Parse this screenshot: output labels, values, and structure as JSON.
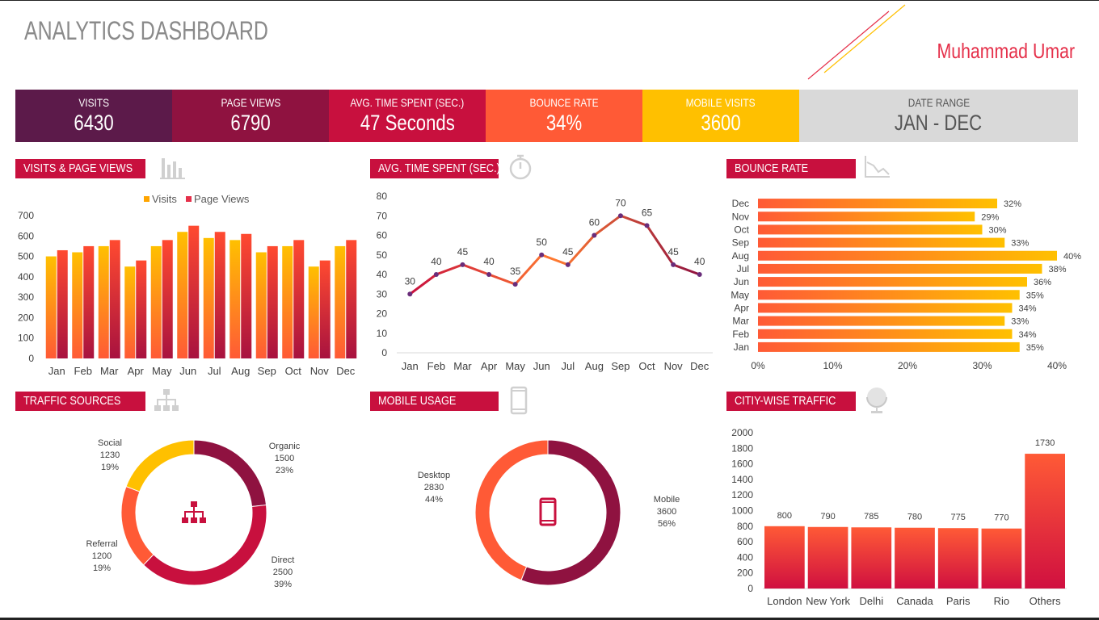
{
  "header": {
    "title": "ANALYTICS DASHBOARD",
    "author": "Muhammad Umar"
  },
  "kpis": [
    {
      "label": "VISITS",
      "value": "6430",
      "color": "#5c1a4a"
    },
    {
      "label": "PAGE VIEWS",
      "value": "6790",
      "color": "#8f1240"
    },
    {
      "label": "AVG. TIME SPENT (SEC.)",
      "value": "47 Seconds",
      "color": "#c8103e"
    },
    {
      "label": "BOUNCE RATE",
      "value": "34%",
      "color": "#ff5a36"
    },
    {
      "label": "MOBILE VISITS",
      "value": "3600",
      "color": "#ffc000"
    },
    {
      "label": "DATE RANGE",
      "value": "JAN - DEC",
      "color": "#d9d9d9"
    }
  ],
  "sections": {
    "visits": "VISITS & PAGE VIEWS",
    "time": "AVG. TIME SPENT (SEC.)",
    "bounce": "BOUNCE RATE",
    "traffic": "TRAFFIC SOURCES",
    "mobile": "MOBILE USAGE",
    "city": "CITIY-WISE TRAFFIC"
  },
  "icons": {
    "visits": "bar-chart-icon",
    "time": "stopwatch-icon",
    "bounce": "declining-area-chart-icon",
    "traffic": "org-chart-icon",
    "mobile": "smartphone-icon",
    "city": "globe-icon"
  },
  "colors": {
    "accent": "#c8103e",
    "yellow": "#ffc000",
    "orange": "#ff5a36",
    "darkred": "#8f1240",
    "axis_text": "#404040"
  },
  "chart_data": [
    {
      "id": "visits_pageviews",
      "type": "bar",
      "categories": [
        "Jan",
        "Feb",
        "Mar",
        "Apr",
        "May",
        "Jun",
        "Jul",
        "Aug",
        "Sep",
        "Oct",
        "Nov",
        "Dec"
      ],
      "series": [
        {
          "name": "Visits",
          "values": [
            500,
            520,
            550,
            450,
            550,
            620,
            590,
            580,
            520,
            550,
            450,
            550
          ]
        },
        {
          "name": "Page Views",
          "values": [
            530,
            550,
            580,
            480,
            580,
            650,
            620,
            610,
            550,
            580,
            480,
            580
          ]
        }
      ],
      "ylim": [
        0,
        700
      ],
      "yticks": [
        0,
        100,
        200,
        300,
        400,
        500,
        600,
        700
      ],
      "legend": "top"
    },
    {
      "id": "avg_time_spent",
      "type": "line",
      "categories": [
        "Jan",
        "Feb",
        "Mar",
        "Apr",
        "May",
        "Jun",
        "Jul",
        "Aug",
        "Sep",
        "Oct",
        "Nov",
        "Dec"
      ],
      "values": [
        30,
        40,
        45,
        40,
        35,
        50,
        45,
        60,
        70,
        65,
        45,
        40
      ],
      "ylim": [
        0,
        80
      ],
      "yticks": [
        0,
        10,
        20,
        30,
        40,
        50,
        60,
        70,
        80
      ],
      "data_labels": true
    },
    {
      "id": "bounce_rate",
      "type": "bar",
      "orientation": "horizontal",
      "categories": [
        "Dec",
        "Nov",
        "Oct",
        "Sep",
        "Aug",
        "Jul",
        "Jun",
        "May",
        "Apr",
        "Mar",
        "Feb",
        "Jan"
      ],
      "values": [
        32,
        29,
        30,
        33,
        40,
        38,
        36,
        35,
        34,
        33,
        34,
        35
      ],
      "value_labels": [
        "32%",
        "29%",
        "30%",
        "33%",
        "40%",
        "38%",
        "36%",
        "35%",
        "34%",
        "33%",
        "34%",
        "35%"
      ],
      "xlim": [
        0,
        40
      ],
      "xticks": [
        "0%",
        "10%",
        "20%",
        "30%",
        "40%"
      ]
    },
    {
      "id": "traffic_sources",
      "type": "pie",
      "donut": true,
      "slices": [
        {
          "name": "Organic",
          "value": 1500,
          "value_label": "1500",
          "pct_label": "23%",
          "color": "#8f1240"
        },
        {
          "name": "Direct",
          "value": 2500,
          "value_label": "2500",
          "pct_label": "39%",
          "color": "#c8103e"
        },
        {
          "name": "Referral",
          "value": 1200,
          "value_label": "1200",
          "pct_label": "19%",
          "color": "#ff5a36"
        },
        {
          "name": "Social",
          "value": 1230,
          "value_label": "1230",
          "pct_label": "19%",
          "color": "#ffc000"
        }
      ]
    },
    {
      "id": "mobile_usage",
      "type": "pie",
      "donut": true,
      "slices": [
        {
          "name": "Mobile",
          "value": 3600,
          "value_label": "3600",
          "pct_label": "56%",
          "color": "#8f1240"
        },
        {
          "name": "Desktop",
          "value": 2830,
          "value_label": "2830",
          "pct_label": "44%",
          "color": "#ff5a36"
        }
      ]
    },
    {
      "id": "city_traffic",
      "type": "bar",
      "categories": [
        "London",
        "New York",
        "Delhi",
        "Canada",
        "Paris",
        "Rio",
        "Others"
      ],
      "values": [
        800,
        790,
        785,
        780,
        775,
        770,
        1730
      ],
      "ylim": [
        0,
        2000
      ],
      "yticks": [
        0,
        200,
        400,
        600,
        800,
        1000,
        1200,
        1400,
        1600,
        1800,
        2000
      ],
      "data_labels": true
    }
  ]
}
